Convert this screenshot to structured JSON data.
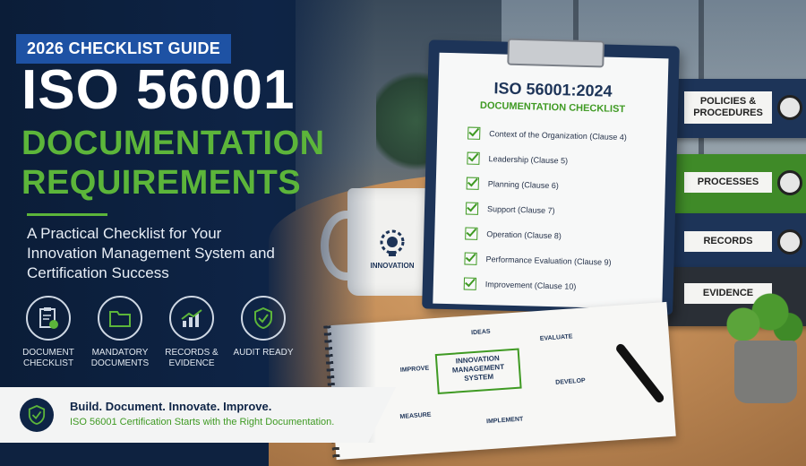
{
  "tag": "2026 CHECKLIST GUIDE",
  "title_line1": "ISO 56001",
  "title_line2": "DOCUMENTATION",
  "title_line3": "REQUIREMENTS",
  "subtitle": "A Practical Checklist for Your Innovation Management System and Certification Success",
  "features": [
    {
      "label": "DOCUMENT CHECKLIST",
      "icon": "clipboard-check-icon"
    },
    {
      "label": "MANDATORY DOCUMENTS",
      "icon": "folder-icon"
    },
    {
      "label": "RECORDS & EVIDENCE",
      "icon": "growth-chart-icon"
    },
    {
      "label": "AUDIT READY",
      "icon": "shield-check-icon"
    }
  ],
  "footer": {
    "line1": "Build. Document. Innovate. Improve.",
    "line2": "ISO 56001 Certification Starts with the Right Documentation."
  },
  "clipboard": {
    "title": "ISO 56001:2024",
    "subtitle": "DOCUMENTATION CHECKLIST",
    "items": [
      "Context of the Organization (Clause 4)",
      "Leadership (Clause 5)",
      "Planning (Clause 6)",
      "Support (Clause 7)",
      "Operation (Clause 8)",
      "Performance Evaluation (Clause 9)",
      "Improvement (Clause 10)"
    ]
  },
  "binders": [
    {
      "label": "POLICIES & PROCEDURES",
      "color": "#1d3458"
    },
    {
      "label": "PROCESSES",
      "color": "#3f8a28"
    },
    {
      "label": "RECORDS",
      "color": "#1d3458"
    },
    {
      "label": "EVIDENCE",
      "color": "#2a2f36"
    }
  ],
  "mug": {
    "label": "INNOVATION",
    "icon": "lightbulb-gear-icon"
  },
  "notebook": {
    "center": "INNOVATION MANAGEMENT SYSTEM",
    "steps": [
      "IDEAS",
      "EVALUATE",
      "DEVELOP",
      "IMPLEMENT",
      "MEASURE",
      "IMPROVE"
    ]
  },
  "colors": {
    "navy": "#0e2446",
    "green": "#5cb53a",
    "blue_tag": "#1e52a4"
  }
}
